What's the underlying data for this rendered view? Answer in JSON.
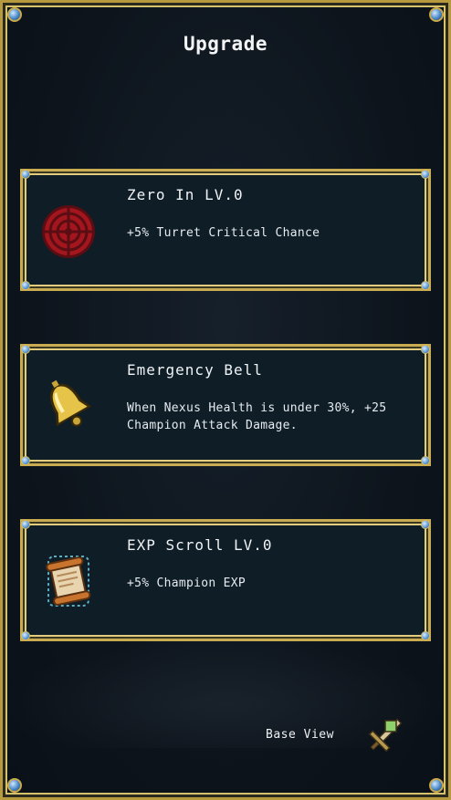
{
  "header": {
    "title": "Upgrade"
  },
  "upgrades": [
    {
      "name": "Zero In LV.0",
      "description": "+5% Turret Critical Chance",
      "icon": "crosshair-target-icon"
    },
    {
      "name": "Emergency Bell",
      "description": "When Nexus Health is under 30%, +25 Champion Attack Damage.",
      "icon": "golden-bell-icon"
    },
    {
      "name": "EXP Scroll LV.0",
      "description": "+5% Champion EXP",
      "icon": "scroll-icon"
    }
  ],
  "footer": {
    "base_view_label": "Base View",
    "base_view_icon": "sword-icon"
  },
  "colors": {
    "frame_gold": "#c9ab52",
    "card_bg": "#0f1d27",
    "background": "#0b121a",
    "gem_blue": "#5a98d8"
  }
}
